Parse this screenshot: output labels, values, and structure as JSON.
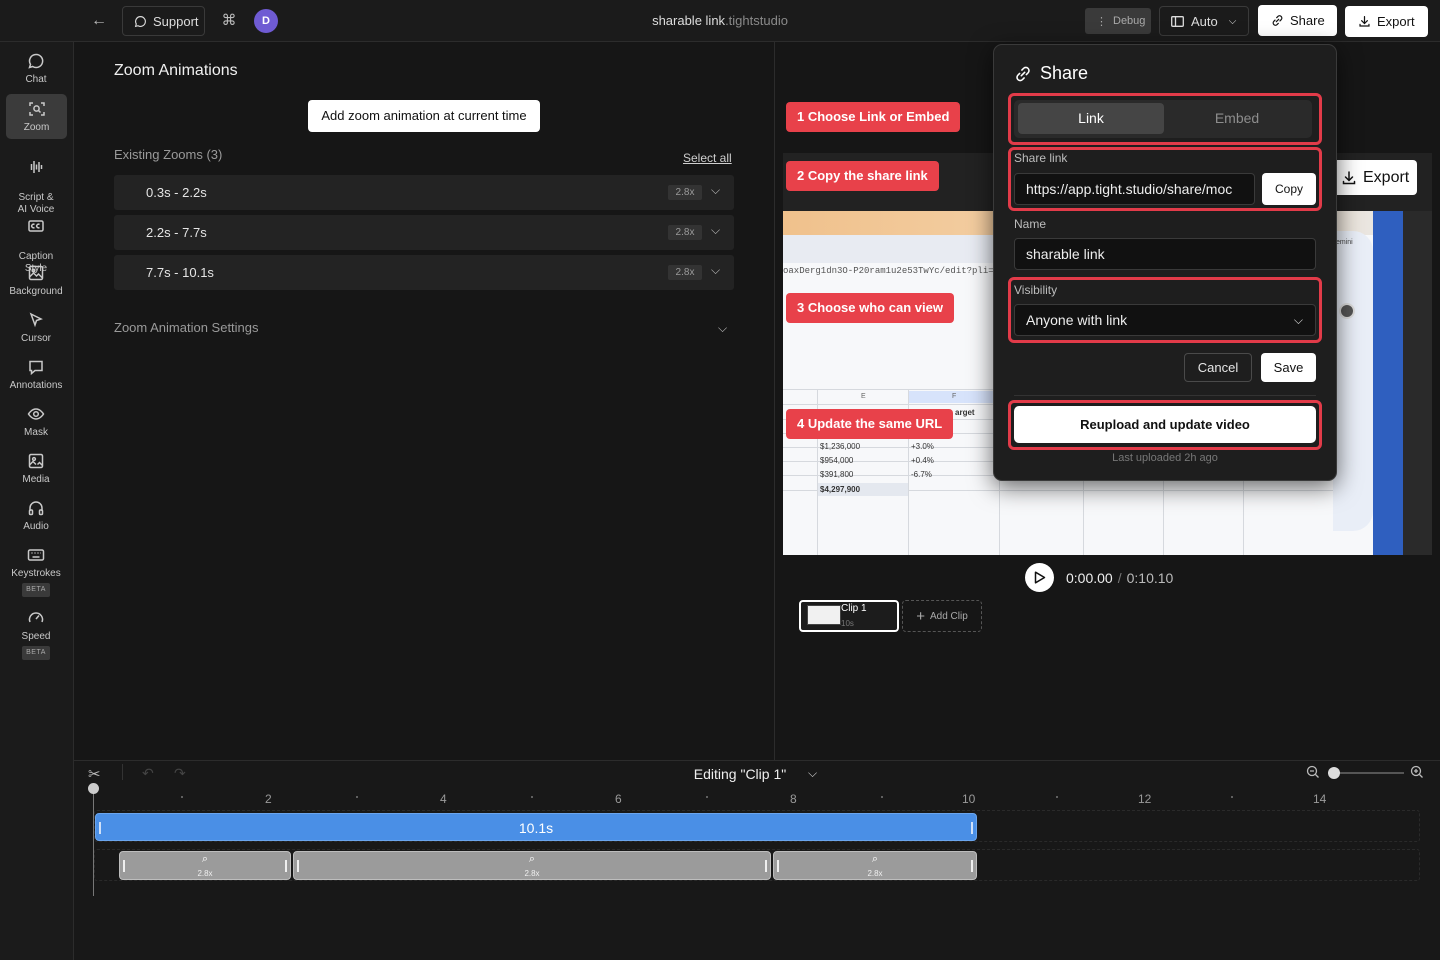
{
  "topbar": {
    "support_label": "Support",
    "avatar_initial": "D",
    "project_name": "sharable link",
    "project_suffix": ".tightstudio",
    "debug_label": "Debug",
    "auto_label": "Auto",
    "share_label": "Share",
    "export_label": "Export"
  },
  "sidebar": {
    "items": [
      {
        "label": "Chat",
        "icon": "chat-icon"
      },
      {
        "label": "Zoom",
        "icon": "zoom-icon"
      },
      {
        "label": "Script &\nAI Voice",
        "icon": "waveform-icon"
      },
      {
        "label": "Caption\nStyle",
        "icon": "caption-icon"
      },
      {
        "label": "Background",
        "icon": "image-icon"
      },
      {
        "label": "Cursor",
        "icon": "cursor-icon"
      },
      {
        "label": "Annotations",
        "icon": "annotation-icon"
      },
      {
        "label": "Mask",
        "icon": "eye-icon"
      },
      {
        "label": "Media",
        "icon": "media-icon"
      },
      {
        "label": "Audio",
        "icon": "headphones-icon"
      },
      {
        "label": "Keystrokes",
        "icon": "keyboard-icon",
        "badge": "BETA"
      },
      {
        "label": "Speed",
        "icon": "gauge-icon",
        "badge": "BETA"
      }
    ],
    "active": "Zoom"
  },
  "zoom_panel": {
    "title": "Zoom Animations",
    "add_button": "Add zoom animation at current time",
    "existing_label": "Existing Zooms (3)",
    "select_all": "Select all",
    "zooms": [
      {
        "range": "0.3s - 2.2s",
        "multiplier": "2.8x"
      },
      {
        "range": "2.2s - 7.7s",
        "multiplier": "2.8x"
      },
      {
        "range": "7.7s - 10.1s",
        "multiplier": "2.8x"
      }
    ],
    "settings_label": "Zoom Animation Settings"
  },
  "preview": {
    "export_label": "Export",
    "url_fragment": "oaxDerg1dn3O-P20ram1u2e53TwYc/edit?pli=",
    "col_e": "E",
    "col_f": "F",
    "target_label": "arget",
    "gemini_label": "emini",
    "rows": [
      {
        "value": "$1,236,000",
        "change": "+3.0%"
      },
      {
        "value": "$954,000",
        "change": "+0.4%"
      },
      {
        "value": "$391,800",
        "change": "-6.7%"
      },
      {
        "value": "$4,297,900",
        "change": ""
      }
    ]
  },
  "callouts": [
    "1 Choose Link or Embed",
    "2 Copy the share link",
    "3 Choose who can view",
    "4 Update the same URL"
  ],
  "share": {
    "title": "Share",
    "tab_link": "Link",
    "tab_embed": "Embed",
    "share_link_label": "Share link",
    "share_link_value": "https://app.tight.studio/share/moc",
    "copy_label": "Copy",
    "name_label": "Name",
    "name_value": "sharable link",
    "visibility_label": "Visibility",
    "visibility_value": "Anyone with link",
    "cancel_label": "Cancel",
    "save_label": "Save",
    "reupload_label": "Reupload and update video",
    "last_uploaded": "Last uploaded 2h ago"
  },
  "playback": {
    "current": "0:00.00",
    "separator": "/",
    "total": "0:10.10",
    "clip_name": "Clip 1",
    "clip_duration": "10s",
    "add_clip": "Add Clip"
  },
  "timeline": {
    "editing_label": "Editing \"Clip 1\"",
    "ticks": [
      "2",
      "4",
      "6",
      "8",
      "10",
      "12",
      "14"
    ],
    "clip_length": "10.1s",
    "zoom_segments": [
      "2.8x",
      "2.8x",
      "2.8x"
    ]
  },
  "colors": {
    "accent_red": "#e23b49",
    "timeline_blue": "#4a8fe6",
    "avatar_purple": "#6f5bd3"
  }
}
